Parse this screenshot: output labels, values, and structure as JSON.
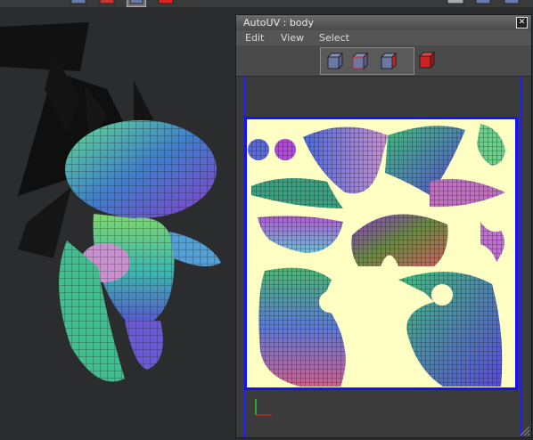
{
  "window": {
    "title": "AutoUV : body",
    "close_label": "✕"
  },
  "menu": {
    "items": [
      "Edit",
      "View",
      "Select"
    ]
  },
  "tools": {
    "mode_buttons": [
      "vertex-mode-icon",
      "edge-mode-icon",
      "face-mode-icon",
      "solid-mode-icon"
    ]
  },
  "colors": {
    "canvas_border": "#1212ff",
    "canvas_bg": "#ffffc4",
    "accent_red": "#cc2222"
  }
}
